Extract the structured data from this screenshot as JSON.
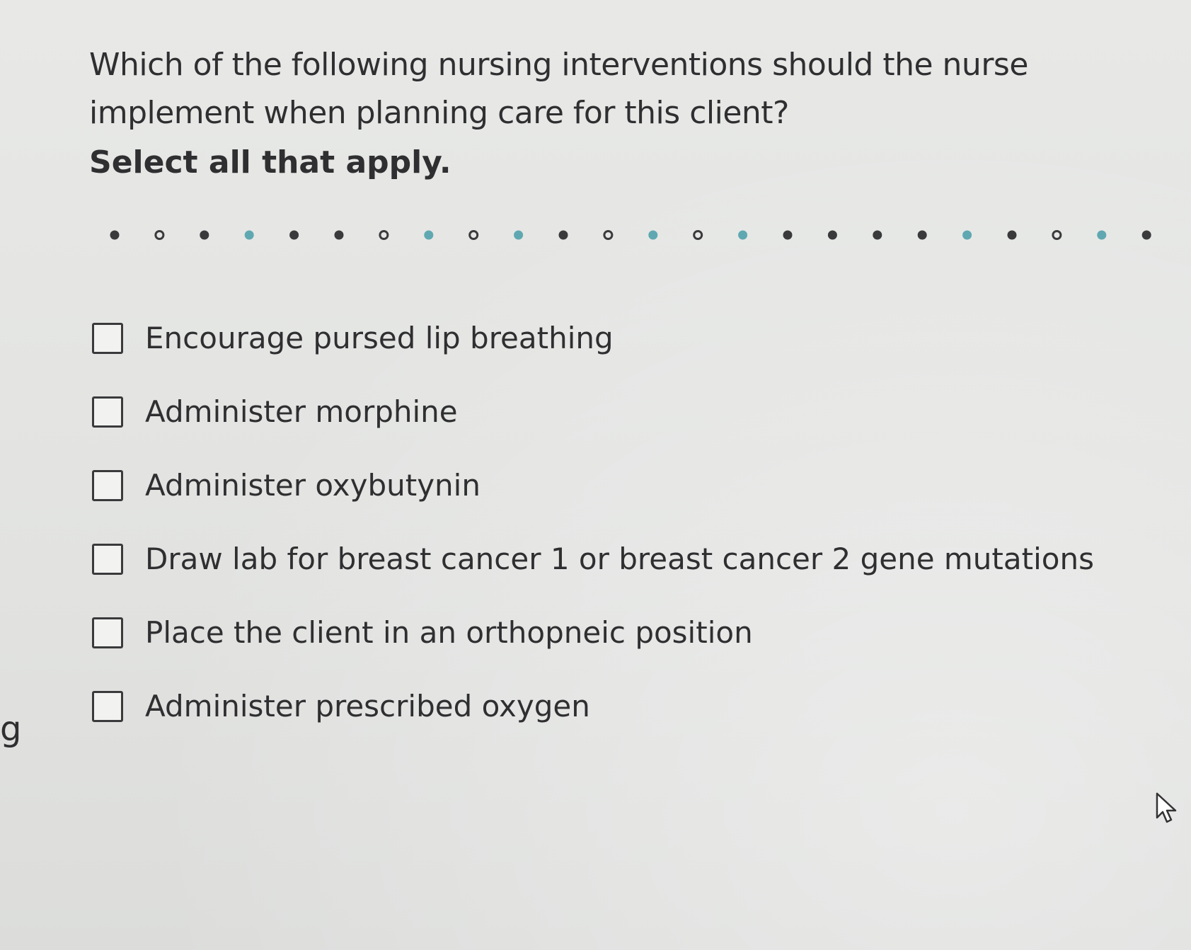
{
  "question": {
    "text": "Which of the following nursing interventions should the nurse implement when planning care for this client?",
    "instruction": "Select all that apply."
  },
  "divider": {
    "dot_styles": [
      "solid",
      "ring",
      "solid",
      "teal",
      "solid",
      "solid",
      "ring",
      "teal",
      "ring",
      "teal",
      "solid",
      "ring",
      "teal",
      "ring",
      "teal",
      "solid",
      "solid",
      "solid",
      "solid",
      "teal",
      "solid",
      "ring",
      "teal",
      "solid"
    ],
    "colors": {
      "dark": "#3a3a3c",
      "teal": "#5fa8b1"
    }
  },
  "options": [
    {
      "label": "Encourage pursed lip breathing",
      "checked": false
    },
    {
      "label": "Administer morphine",
      "checked": false
    },
    {
      "label": "Administer oxybutynin",
      "checked": false
    },
    {
      "label": "Draw lab for breast cancer 1 or breast cancer 2 gene mutations",
      "checked": false
    },
    {
      "label": "Place the client in an orthopneic position",
      "checked": false
    },
    {
      "label": "Administer prescribed oxygen",
      "checked": false
    }
  ],
  "edge_text": "g",
  "cursor_icon": "mouse-pointer-icon"
}
